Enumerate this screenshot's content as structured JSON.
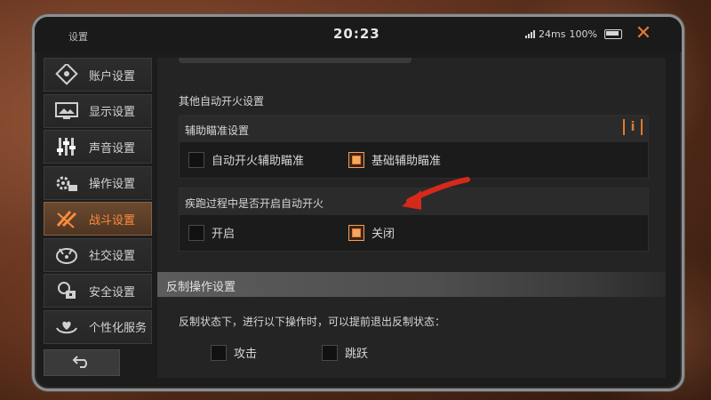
{
  "header": {
    "title": "设置",
    "time": "20:23",
    "network": "24ms",
    "battery": "100%"
  },
  "sidebar": {
    "items": [
      {
        "label": "账户设置",
        "icon": "account-icon"
      },
      {
        "label": "显示设置",
        "icon": "display-icon"
      },
      {
        "label": "声音设置",
        "icon": "sound-icon"
      },
      {
        "label": "操作设置",
        "icon": "controls-icon"
      },
      {
        "label": "战斗设置",
        "icon": "combat-icon",
        "active": true
      },
      {
        "label": "社交设置",
        "icon": "social-icon"
      },
      {
        "label": "安全设置",
        "icon": "security-icon"
      },
      {
        "label": "个性化服务",
        "icon": "personalization-icon"
      }
    ],
    "back_icon": "back-arrow-icon"
  },
  "main": {
    "section_title": "其他自动开火设置",
    "aim_panel": {
      "label": "辅助瞄准设置",
      "options": [
        {
          "label": "自动开火辅助瞄准",
          "checked": false
        },
        {
          "label": "基础辅助瞄准",
          "checked": true
        }
      ]
    },
    "sprint_panel": {
      "label": "疾跑过程中是否开启自动开火",
      "options": [
        {
          "label": "开启",
          "checked": false
        },
        {
          "label": "关闭",
          "checked": true
        }
      ]
    },
    "counter_section": {
      "label": "反制操作设置",
      "description": "反制状态下，进行以下操作时，可以提前退出反制状态：",
      "options": [
        {
          "label": "攻击",
          "checked": false
        },
        {
          "label": "跳跃",
          "checked": false
        }
      ]
    }
  },
  "colors": {
    "accent": "#e07a2e",
    "annotation_arrow": "#d42a1a"
  }
}
